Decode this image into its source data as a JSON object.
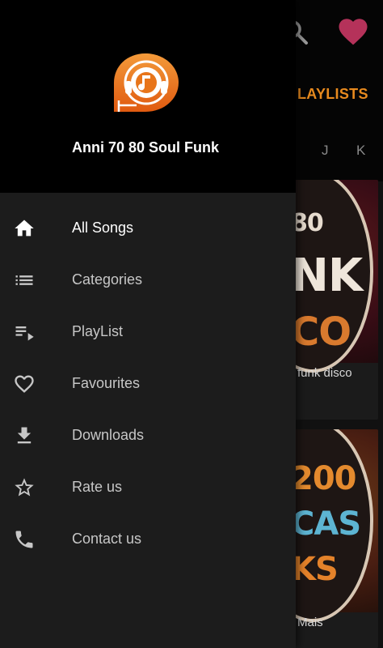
{
  "background": {
    "tab_playlists": "LAYLISTS",
    "alphabet": [
      "J",
      "K"
    ],
    "cards": [
      {
        "art_lines": [
          "80",
          "NK",
          "CO"
        ],
        "caption": "funk disco"
      },
      {
        "art_lines": [
          "200",
          "CAS",
          "KS"
        ],
        "caption": "Mais"
      }
    ]
  },
  "drawer": {
    "app_name": "Anni 70 80 Soul Funk",
    "menu": [
      {
        "label": "All Songs",
        "icon": "home-icon",
        "active": true
      },
      {
        "label": "Categories",
        "icon": "list-icon",
        "active": false
      },
      {
        "label": "PlayList",
        "icon": "playlist-icon",
        "active": false
      },
      {
        "label": "Favourites",
        "icon": "heart-outline-icon",
        "active": false
      },
      {
        "label": "Downloads",
        "icon": "download-icon",
        "active": false
      },
      {
        "label": "Rate us",
        "icon": "star-outline-icon",
        "active": false
      },
      {
        "label": "Contact us",
        "icon": "phone-icon",
        "active": false
      }
    ]
  },
  "colors": {
    "accent_orange": "#e8751a",
    "heart_pink": "#b5325a",
    "drawer_bg": "#1c1c1c",
    "header_bg": "#000000"
  }
}
